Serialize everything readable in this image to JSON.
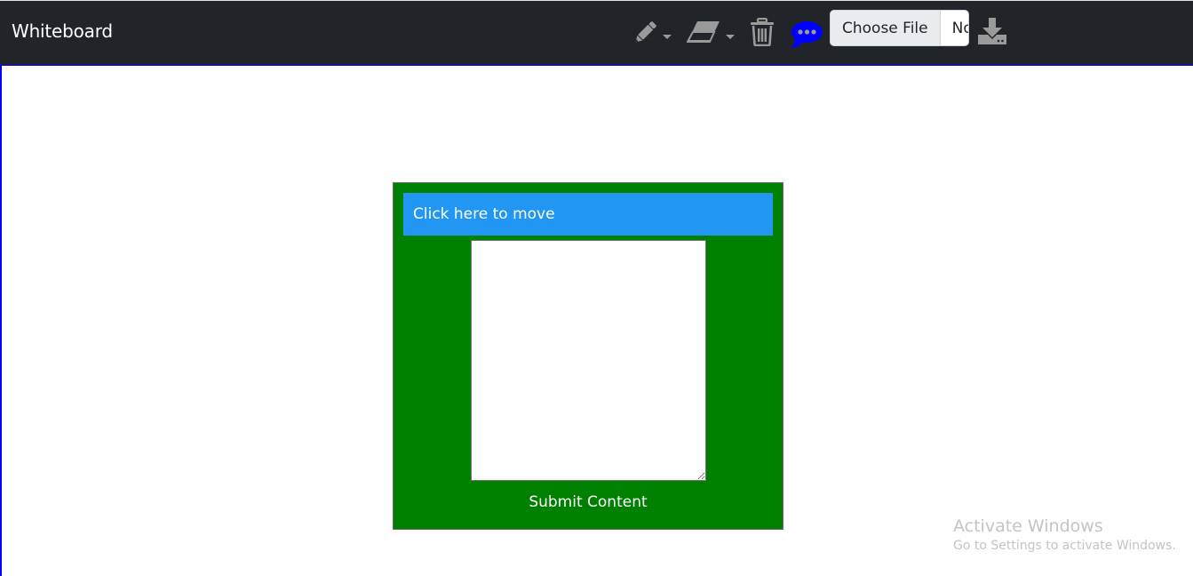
{
  "app": {
    "title": "Whiteboard"
  },
  "toolbar": {
    "tools": [
      {
        "name": "pencil-tool",
        "icon": "pencil-icon",
        "has_dropdown": true
      },
      {
        "name": "eraser-tool",
        "icon": "eraser-icon",
        "has_dropdown": true
      },
      {
        "name": "clear-tool",
        "icon": "trash-icon",
        "has_dropdown": false
      },
      {
        "name": "comment-tool",
        "icon": "comment-dots-icon",
        "has_dropdown": false,
        "active_color": "#0000ff"
      }
    ],
    "file_input": {
      "button_label": "Choose File",
      "status_text": "No file chosen"
    },
    "download_icon": "download-icon",
    "icon_color": "#9a9a9a",
    "background_color": "#212529"
  },
  "canvas": {
    "border_color": "#0000ff",
    "note": {
      "header_label": "Click here to move",
      "textarea_value": "",
      "submit_label": "Submit Content",
      "background_color": "#008000",
      "header_color": "#2196f3"
    }
  },
  "watermark": {
    "title": "Activate Windows",
    "subtitle": "Go to Settings to activate Windows."
  }
}
